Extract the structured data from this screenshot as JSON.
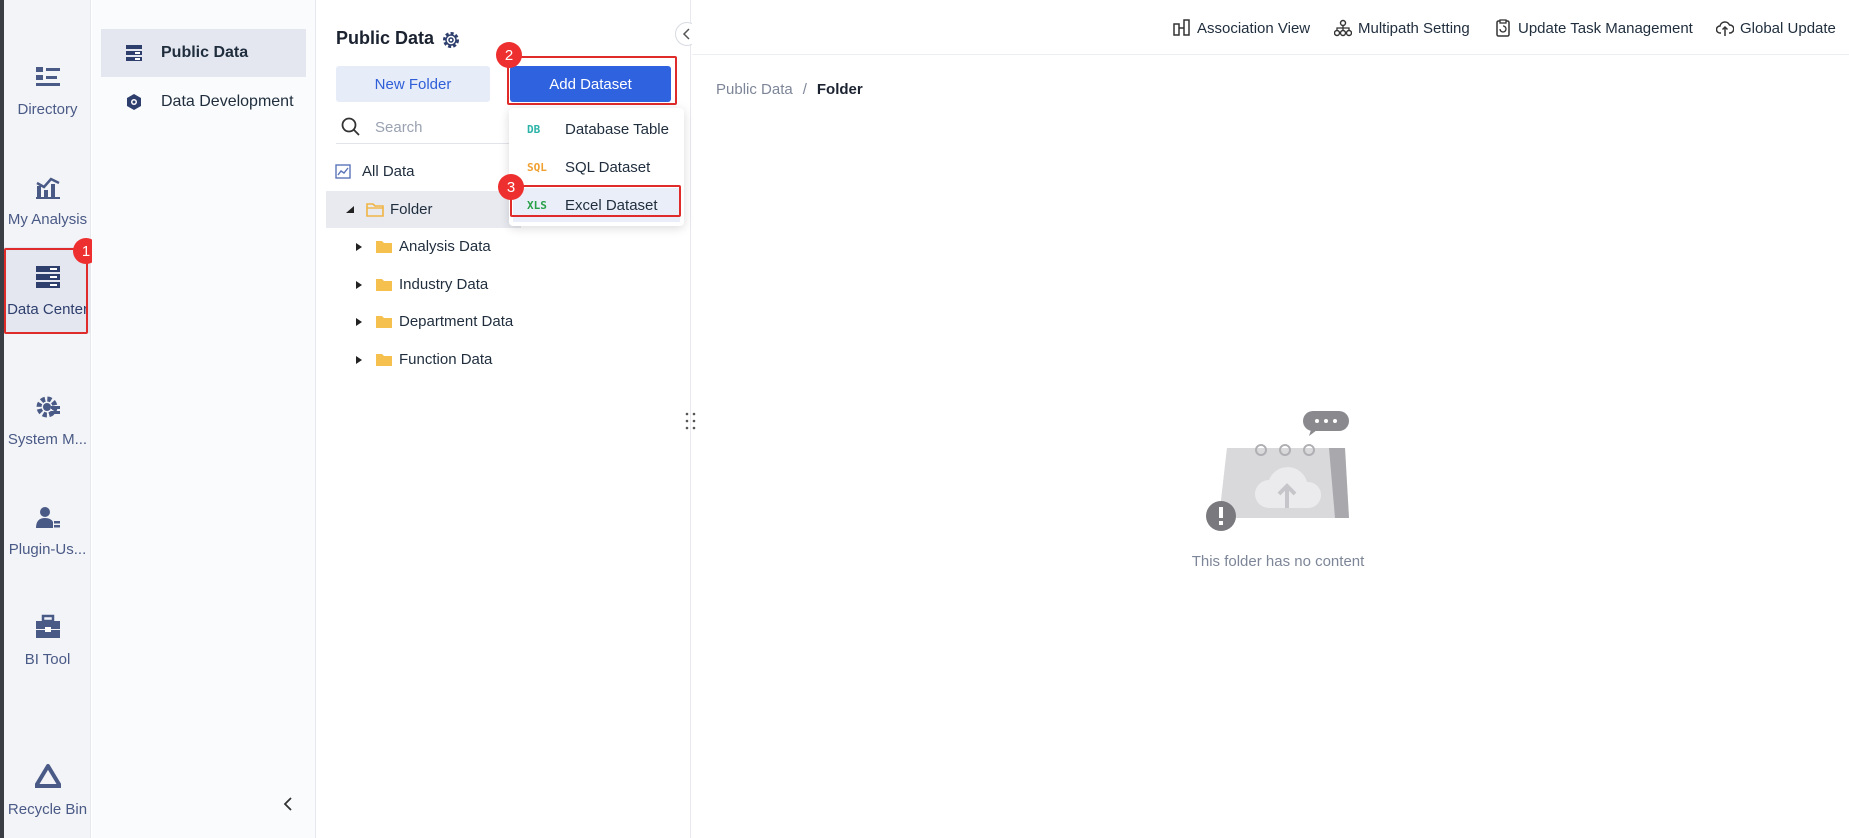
{
  "rail": {
    "items": [
      {
        "label": "Directory",
        "icon": "directory-icon"
      },
      {
        "label": "My Analysis",
        "icon": "analysis-chart-icon"
      },
      {
        "label": "Data Center",
        "icon": "data-center-icon"
      },
      {
        "label": "System M...",
        "icon": "system-gear-icon"
      },
      {
        "label": "Plugin-Us...",
        "icon": "plugin-user-icon"
      },
      {
        "label": "BI Tool",
        "icon": "toolbox-icon"
      },
      {
        "label": "Recycle Bin",
        "icon": "recycle-bin-icon"
      }
    ]
  },
  "subnav": {
    "items": [
      {
        "label": "Public Data",
        "icon": "public-data-icon"
      },
      {
        "label": "Data Development",
        "icon": "data-development-icon"
      }
    ]
  },
  "tree_panel": {
    "title": "Public Data",
    "new_folder_label": "New Folder",
    "add_dataset_label": "Add Dataset",
    "search_placeholder": "Search",
    "all_data_label": "All Data",
    "nodes": [
      {
        "label": "Folder",
        "expanded": true,
        "selected": true
      },
      {
        "label": "Analysis Data"
      },
      {
        "label": "Industry Data"
      },
      {
        "label": "Department Data"
      },
      {
        "label": "Function Data"
      }
    ]
  },
  "dropdown": {
    "items": [
      {
        "tag": "DB",
        "label": "Database Table",
        "tag_color": "#2bb3a8"
      },
      {
        "tag": "SQL",
        "label": "SQL Dataset",
        "tag_color": "#f0a030"
      },
      {
        "tag": "XLS",
        "label": "Excel Dataset",
        "tag_color": "#27a046"
      }
    ]
  },
  "annotations": [
    "1",
    "2",
    "3"
  ],
  "topbar": {
    "actions": [
      {
        "label": "Association View",
        "icon": "association-view-icon"
      },
      {
        "label": "Multipath Setting",
        "icon": "multipath-icon"
      },
      {
        "label": "Update Task Management",
        "icon": "task-management-icon"
      },
      {
        "label": "Global Update",
        "icon": "cloud-update-icon"
      }
    ]
  },
  "breadcrumb": {
    "root": "Public Data",
    "separator": "/",
    "current": "Folder"
  },
  "empty_state": {
    "text": "This folder has no content"
  },
  "colors": {
    "primary": "#2f62df",
    "highlight": "#e02b2b",
    "rail_text": "#4a5a86",
    "folder": "#f5c04e"
  }
}
